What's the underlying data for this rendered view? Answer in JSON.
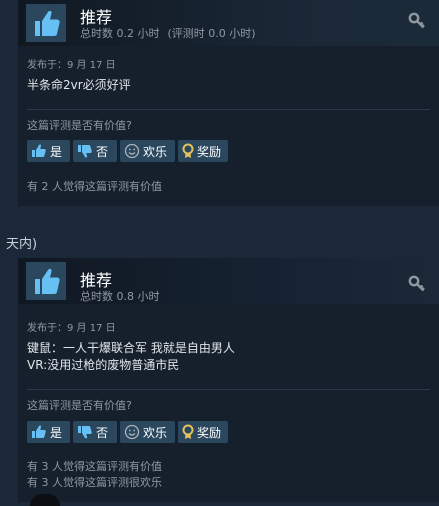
{
  "between_text": "天内)",
  "reviews": [
    {
      "title": "推荐",
      "hours": "总时数 0.2 小时",
      "hours_at_review": "(评测时 0.0 小时)",
      "posted": "发布于：9 月 17 日",
      "content": [
        "半条命2vr必须好评"
      ],
      "helpful_question": "这篇评测是否有价值?",
      "buttons": {
        "yes": "是",
        "no": "否",
        "funny": "欢乐",
        "award": "奖励"
      },
      "found_helpful": [
        "有 2 人觉得这篇评测有价值"
      ]
    },
    {
      "title": "推荐",
      "hours": "总时数 0.8 小时",
      "posted": "发布于：9 月 17 日",
      "content": [
        "键鼠：一人干爆联合军 我就是自由男人",
        "VR:没用过枪的废物普通市民"
      ],
      "helpful_question": "这篇评测是否有价值?",
      "buttons": {
        "yes": "是",
        "no": "否",
        "funny": "欢乐",
        "award": "奖励"
      },
      "found_helpful": [
        "有 3 人觉得这篇评测有价值",
        "有 3 人觉得这篇评测很欢乐"
      ]
    }
  ],
  "colors": {
    "thumb": "#66c0f4",
    "award": "#e5c15b",
    "button_bg": "#2a475e"
  }
}
